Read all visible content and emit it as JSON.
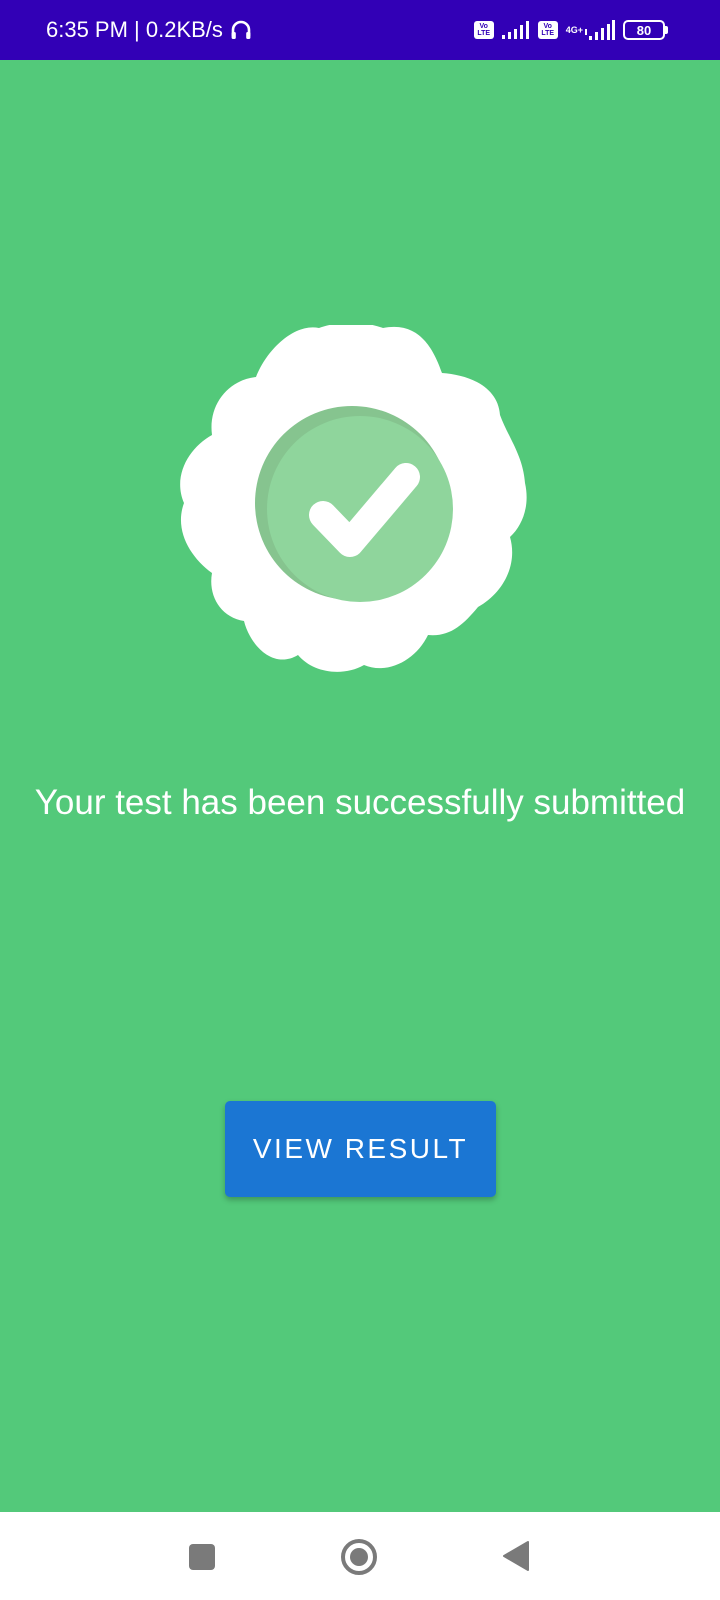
{
  "status_bar": {
    "time": "6:35 PM | 0.2KB/s",
    "volte_top": "Vo",
    "volte_bottom": "LTE",
    "network_type": "4G+",
    "battery_level": "80",
    "icons": [
      "headphones-icon",
      "volte-icon",
      "signal-icon",
      "volte-icon",
      "signal-icon",
      "battery-icon"
    ]
  },
  "main": {
    "background_color": "#53c97a",
    "badge_icon": "verified-check-badge-icon",
    "message": "Your test has been successfully submitted",
    "button_label": "VIEW RESULT",
    "button_color": "#1b76d3"
  },
  "nav_bar": {
    "icons": [
      "recent-apps-icon",
      "home-icon",
      "back-icon"
    ]
  }
}
